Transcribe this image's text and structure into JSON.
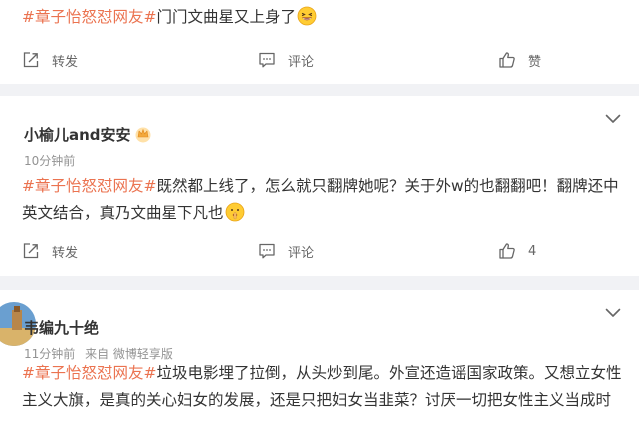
{
  "posts": [
    {
      "hashtag": "#章子怡怒怼网友#",
      "text": "门门文曲星又上身了",
      "emoji": "grinning-squint-emoji",
      "actions": {
        "repost": "转发",
        "comment": "评论",
        "like": "赞"
      }
    },
    {
      "username": "小榆儿and安安",
      "badge": "crown-badge-icon",
      "time": "10分钟前",
      "hashtag": "#章子怡怒怼网友#",
      "text_line1": "既然都上线了，怎么就只翻牌她呢？关于外w的也翻翻吧！翻牌还中",
      "text_line2": "英文结合，真乃文曲星下凡也",
      "emoji": "shushing-face-emoji",
      "actions": {
        "repost": "转发",
        "comment": "评论",
        "like": "4"
      }
    },
    {
      "username": "韦编九十绝",
      "time": "11分钟前",
      "source": "来自 微博轻享版",
      "hashtag": "#章子怡怒怼网友#",
      "text_line1": "垃圾电影埋了拉倒，从头炒到尾。外宣还造谣国家政策。又想立女性",
      "text_line2": "主义大旗，是真的关心妇女的发展，还是只把妇女当韭菜？讨厌一切把女性主义当成时"
    }
  ],
  "colors": {
    "hashtag": "#eb7350",
    "text": "#333333",
    "meta": "#939393",
    "background": "#f1f2f5"
  }
}
